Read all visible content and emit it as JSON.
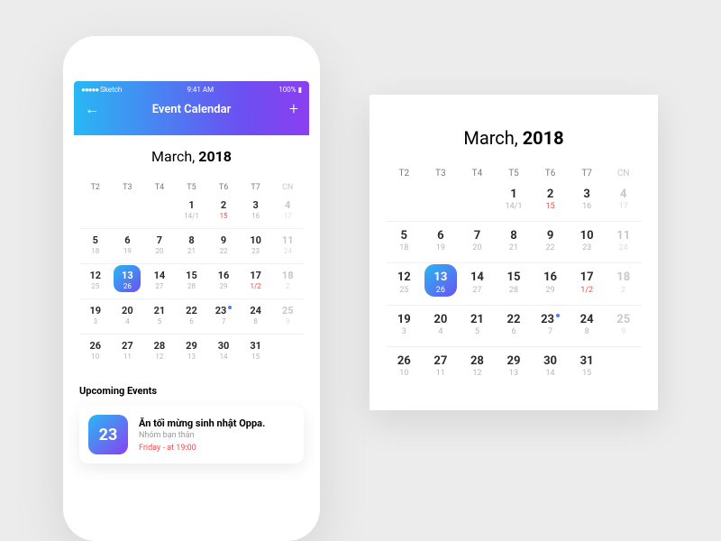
{
  "status": {
    "carrier": "Sketch",
    "signal": "●●●●●",
    "time": "9:41 AM",
    "batt": "100%"
  },
  "header": {
    "title": "Event Calendar"
  },
  "month_label": "March,",
  "year_label": "2018",
  "dows": [
    "T2",
    "T3",
    "T4",
    "T5",
    "T6",
    "T7",
    "CN"
  ],
  "calendar": {
    "selected_g": 13,
    "dotted": [
      23
    ],
    "rows": [
      [
        null,
        null,
        null,
        {
          "g": 1,
          "l": "14/1"
        },
        {
          "g": 2,
          "l": "15",
          "lr": true
        },
        {
          "g": 3,
          "l": "16"
        },
        {
          "g": 4,
          "l": "17",
          "w": true
        }
      ],
      [
        {
          "g": 5,
          "l": "18"
        },
        {
          "g": 6,
          "l": "19"
        },
        {
          "g": 7,
          "l": "20"
        },
        {
          "g": 8,
          "l": "21"
        },
        {
          "g": 9,
          "l": "22"
        },
        {
          "g": 10,
          "l": "23"
        },
        {
          "g": 11,
          "l": "24",
          "w": true
        }
      ],
      [
        {
          "g": 12,
          "l": "25"
        },
        {
          "g": 13,
          "l": "26"
        },
        {
          "g": 14,
          "l": "27"
        },
        {
          "g": 15,
          "l": "28"
        },
        {
          "g": 16,
          "l": "29"
        },
        {
          "g": 17,
          "l": "1/2",
          "lr": true
        },
        {
          "g": 18,
          "l": "2",
          "w": true
        }
      ],
      [
        {
          "g": 19,
          "l": "3"
        },
        {
          "g": 20,
          "l": "4"
        },
        {
          "g": 21,
          "l": "5"
        },
        {
          "g": 22,
          "l": "6"
        },
        {
          "g": 23,
          "l": "7"
        },
        {
          "g": 24,
          "l": "8"
        },
        {
          "g": 25,
          "l": "9",
          "w": true
        }
      ],
      [
        {
          "g": 26,
          "l": "10"
        },
        {
          "g": 27,
          "l": "11"
        },
        {
          "g": 28,
          "l": "12"
        },
        {
          "g": 29,
          "l": "13"
        },
        {
          "g": 30,
          "l": "14"
        },
        {
          "g": 31,
          "l": "15"
        },
        null
      ]
    ]
  },
  "upcoming_label": "Upcoming Events",
  "event": {
    "day": "23",
    "title": "Ăn tối mừng sinh nhật Oppa.",
    "subtitle": "Nhóm bạn thân",
    "time": "Friday - at 19:00"
  }
}
